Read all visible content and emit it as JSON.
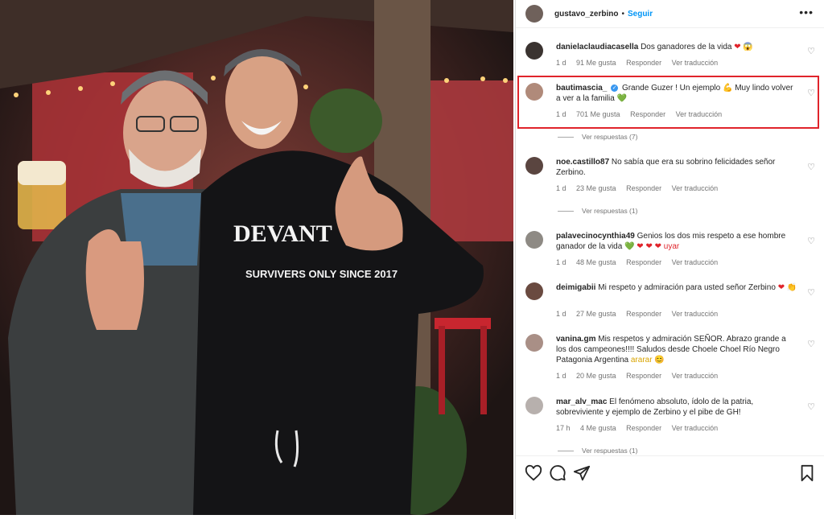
{
  "post": {
    "username": "gustavo_zerbino",
    "separator": "•",
    "follow_label": "Seguir",
    "more_label": "•••",
    "photo_shirt_text": "DEVANT",
    "photo_shirt_sub": "SURVIVERS ONLY SINCE 2017"
  },
  "colors": {
    "highlight": "#e0242b",
    "link": "#0095f6"
  },
  "comments": [
    {
      "username": "danielaclaudiacasella",
      "text": "Dos ganadores de la vida",
      "emoji": "❤ 😱",
      "time": "1 d",
      "likes": "91 Me gusta",
      "reply": "Responder",
      "translate": "Ver traducción"
    },
    {
      "username": "bautimascia_",
      "verified": "✓",
      "text": "Grande Guzer ! Un ejemplo 💪 Muy lindo volver a ver a la familia",
      "emoji": "💚",
      "time": "1 d",
      "likes": "701 Me gusta",
      "reply": "Responder",
      "translate": "Ver traducción",
      "replies": "Ver respuestas (7)"
    },
    {
      "username": "noe.castillo87",
      "text": "No sabía que era su sobrino felicidades señor Zerbino.",
      "time": "1 d",
      "likes": "23 Me gusta",
      "reply": "Responder",
      "translate": "Ver traducción",
      "replies": "Ver respuestas (1)"
    },
    {
      "username": "palavecinocynthia49",
      "text": "Genios los dos mis respeto a ese hombre ganador de la vida",
      "emoji": "💚 ❤ ❤ ❤ uyar",
      "time": "1 d",
      "likes": "48 Me gusta",
      "reply": "Responder",
      "translate": "Ver traducción"
    },
    {
      "username": "deimigabii",
      "text": "Mi respeto y admiración para usted señor Zerbino",
      "emoji": "❤ 👏",
      "time": "1 d",
      "likes": "27 Me gusta",
      "reply": "Responder",
      "translate": "Ver traducción"
    },
    {
      "username": "vanina.gm",
      "text": "Mis respetos y admiración SEÑOR. Abrazo grande a los dos campeones!!!! Saludos desde Choele Choel Río Negro Patagonia Argentina",
      "emoji": "ararar 😊",
      "time": "1 d",
      "likes": "20 Me gusta",
      "reply": "Responder",
      "translate": "Ver traducción"
    },
    {
      "username": "mar_alv_mac",
      "text": "El fenómeno absoluto, ídolo de la patria, sobreviviente y ejemplo de Zerbino y el pibe de GH!",
      "time": "17 h",
      "likes": "4 Me gusta",
      "reply": "Responder",
      "translate": "Ver traducción",
      "replies": "Ver respuestas (1)"
    }
  ],
  "icons": {
    "like": "heart-icon",
    "comment": "comment-icon",
    "share": "share-icon",
    "save": "bookmark-icon"
  }
}
